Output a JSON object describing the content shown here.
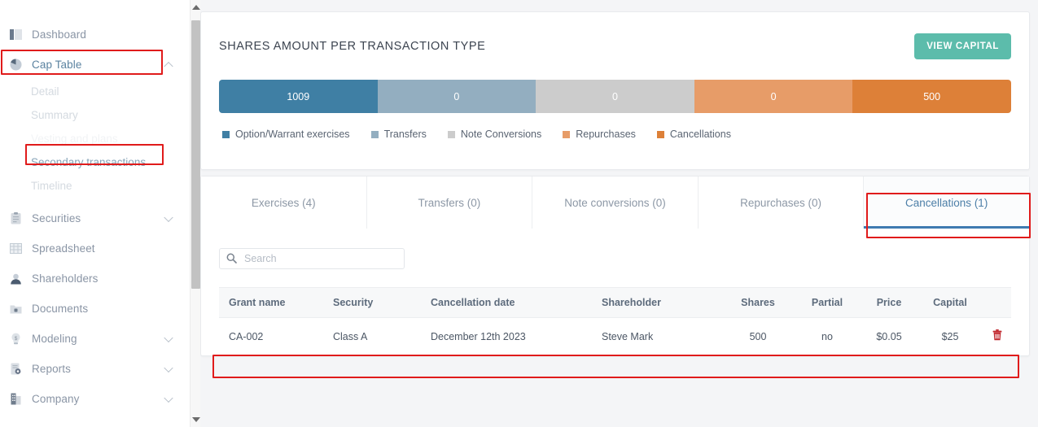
{
  "sidebar": {
    "items": [
      {
        "label": "Dashboard",
        "icon": "dashboard-icon",
        "state": "normal",
        "expand": "none"
      },
      {
        "label": "Cap Table",
        "icon": "pie-chart-icon",
        "state": "active",
        "expand": "up"
      },
      {
        "label": "Securities",
        "icon": "clipboard-icon",
        "state": "normal",
        "expand": "down"
      },
      {
        "label": "Spreadsheet",
        "icon": "grid-icon",
        "state": "normal",
        "expand": "none"
      },
      {
        "label": "Shareholders",
        "icon": "person-icon",
        "state": "normal",
        "expand": "none"
      },
      {
        "label": "Documents",
        "icon": "folder-lock-icon",
        "state": "normal",
        "expand": "none"
      },
      {
        "label": "Modeling",
        "icon": "lightbulb-icon",
        "state": "normal",
        "expand": "down"
      },
      {
        "label": "Reports",
        "icon": "report-icon",
        "state": "normal",
        "expand": "down"
      },
      {
        "label": "Company",
        "icon": "building-icon",
        "state": "normal",
        "expand": "down"
      }
    ],
    "subitems": [
      {
        "label": "Detail",
        "state": "dim"
      },
      {
        "label": "Summary",
        "state": "dim"
      },
      {
        "label": "Vesting and plans",
        "state": "faded"
      },
      {
        "label": "Secondary transactions",
        "state": "linked"
      },
      {
        "label": "Timeline",
        "state": "dim"
      }
    ]
  },
  "header": {
    "title": "SHARES AMOUNT PER TRANSACTION TYPE",
    "view_capital_label": "VIEW CAPITAL",
    "view_capital_color": "#5cbcab"
  },
  "chart_data": {
    "type": "bar",
    "title": "SHARES AMOUNT PER TRANSACTION TYPE",
    "orientation": "horizontal-stacked-equal-width",
    "categories": [
      "Option/Warrant exercises",
      "Transfers",
      "Note Conversions",
      "Repurchases",
      "Cancellations"
    ],
    "values": [
      1009,
      0,
      0,
      0,
      500
    ],
    "value_labels": [
      "1009",
      "0",
      "0",
      "0",
      "500"
    ],
    "colors": [
      "#3f7fa4",
      "#93aec0",
      "#cccccc",
      "#e79c68",
      "#dd8038"
    ],
    "legend_position": "bottom",
    "grid": false,
    "xlabel": "",
    "ylabel": ""
  },
  "tabs": [
    {
      "label": "Exercises (4)",
      "active": false
    },
    {
      "label": "Transfers (0)",
      "active": false
    },
    {
      "label": "Note conversions (0)",
      "active": false
    },
    {
      "label": "Repurchases (0)",
      "active": false
    },
    {
      "label": "Cancellations (1)",
      "active": true
    }
  ],
  "search": {
    "value": "",
    "placeholder": "Search"
  },
  "table": {
    "columns": [
      "Grant name",
      "Security",
      "Cancellation date",
      "Shareholder",
      "Shares",
      "Partial",
      "Price",
      "Capital",
      ""
    ],
    "rows": [
      {
        "grant_name": "CA-002",
        "security": "Class A",
        "cancellation_date": "December 12th 2023",
        "shareholder": "Steve Mark",
        "shares": "500",
        "partial": "no",
        "price": "$0.05",
        "capital": "$25",
        "action": "delete-icon"
      }
    ]
  },
  "annotations": {
    "highlight_color": "#e01b1b",
    "boxes": [
      "cap-table-nav",
      "secondary-transactions-nav",
      "cancellations-tab",
      "table-row-1"
    ]
  }
}
